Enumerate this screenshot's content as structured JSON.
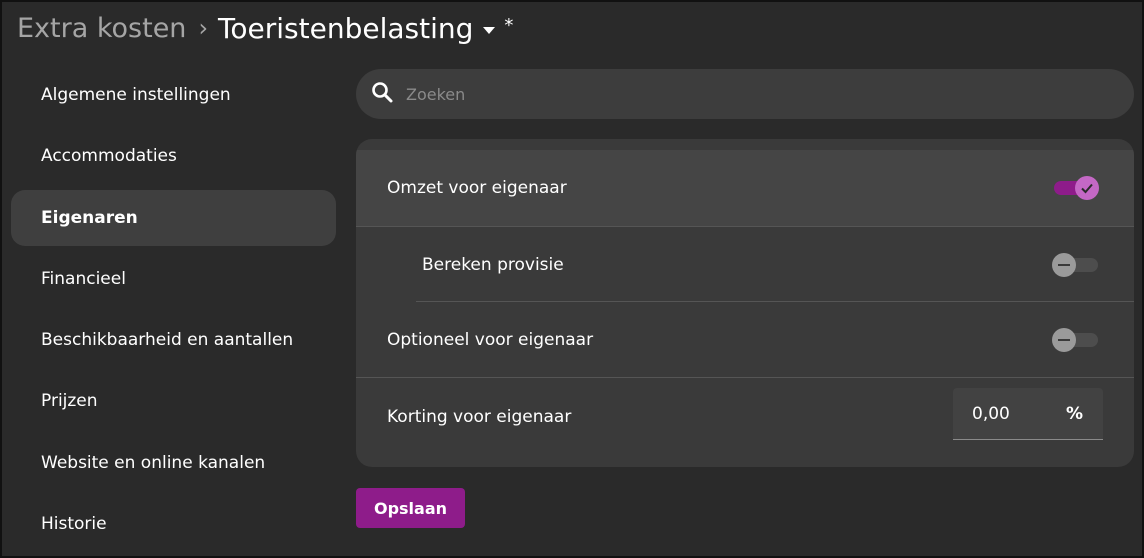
{
  "header": {
    "parent": "Extra kosten",
    "separator": "›",
    "current": "Toeristenbelasting",
    "dirty_marker": "*"
  },
  "sidebar": {
    "items": [
      {
        "label": "Algemene instellingen",
        "active": false
      },
      {
        "label": "Accommodaties",
        "active": false
      },
      {
        "label": "Eigenaren",
        "active": true
      },
      {
        "label": "Financieel",
        "active": false
      },
      {
        "label": "Beschikbaarheid en aantallen",
        "active": false
      },
      {
        "label": "Prijzen",
        "active": false
      },
      {
        "label": "Website en online kanalen",
        "active": false
      },
      {
        "label": "Historie",
        "active": false
      }
    ]
  },
  "search": {
    "placeholder": "Zoeken",
    "value": "",
    "icon": "search-icon"
  },
  "settings": {
    "omzet_label": "Omzet voor eigenaar",
    "omzet_on": true,
    "provisie_label": "Bereken provisie",
    "provisie_on": false,
    "optioneel_label": "Optioneel voor eigenaar",
    "optioneel_on": false,
    "korting_label": "Korting voor eigenaar",
    "korting_value": "0,00",
    "korting_unit": "%"
  },
  "actions": {
    "save_label": "Opslaan"
  },
  "colors": {
    "accent": "#8e1c8a",
    "accent_light": "#c468c5",
    "background": "#2a2a2a",
    "card": "#3a3a3a"
  }
}
